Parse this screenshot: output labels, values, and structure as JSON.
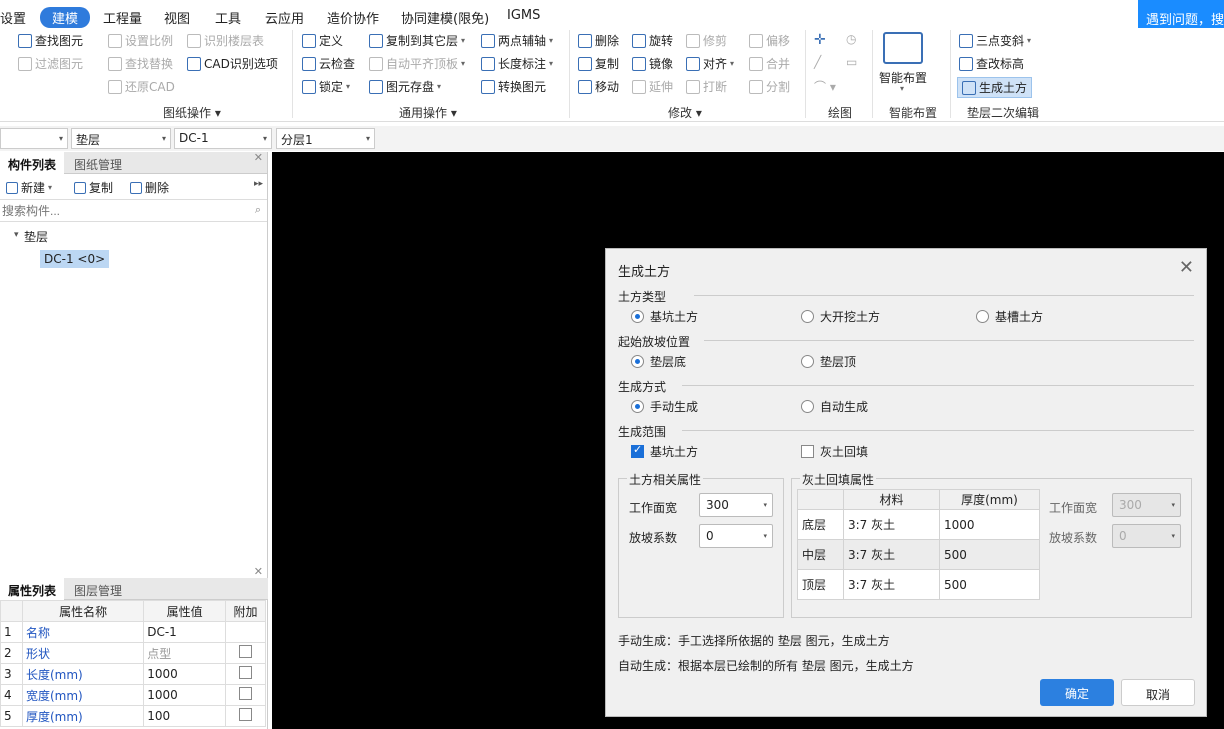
{
  "menu": {
    "items": [
      "设置",
      "建模",
      "工程量",
      "视图",
      "工具",
      "云应用",
      "造价协作",
      "协同建模(限免)",
      "IGMS"
    ],
    "active_index": 1
  },
  "help": "遇到问题，搜一",
  "ribbon": {
    "col1": [
      "查找图元",
      "过滤图元"
    ],
    "col2": [
      "设置比例",
      "识别楼层表",
      "查找替换",
      "CAD识别选项",
      "还原CAD"
    ],
    "group1": "图纸操作",
    "col3": [
      "定义",
      "复制到其它层",
      "两点辅轴",
      "云检查",
      "自动平齐顶板",
      "长度标注",
      "锁定",
      "图元存盘",
      "转换图元"
    ],
    "group2": "通用操作",
    "col4": [
      "删除",
      "旋转",
      "修剪",
      "偏移",
      "复制",
      "镜像",
      "对齐",
      "合并",
      "移动",
      "延伸",
      "打断",
      "分割"
    ],
    "group3": "修改",
    "group4": "绘图",
    "smart": "智能布置",
    "group5": "智能布置",
    "col5": [
      "三点变斜",
      "查改标高",
      "生成土方"
    ],
    "group6": "垫层二次编辑"
  },
  "selectors": [
    "",
    "垫层",
    "DC-1",
    "分层1"
  ],
  "left": {
    "tabs": [
      "构件列表",
      "图纸管理"
    ],
    "toolbar": [
      "新建",
      "复制",
      "删除"
    ],
    "search_placeholder": "搜索构件...",
    "tree_root": "垫层",
    "tree_item": "DC-1 <0>",
    "prop_tabs": [
      "属性列表",
      "图层管理"
    ],
    "prop_headers": [
      "属性名称",
      "属性值",
      "附加"
    ],
    "props": [
      {
        "n": "1",
        "name": "名称",
        "val": "DC-1",
        "chk": false
      },
      {
        "n": "2",
        "name": "形状",
        "val": "点型",
        "chk": true
      },
      {
        "n": "3",
        "name": "长度(mm)",
        "val": "1000",
        "chk": true
      },
      {
        "n": "4",
        "name": "宽度(mm)",
        "val": "1000",
        "chk": true
      },
      {
        "n": "5",
        "name": "厚度(mm)",
        "val": "100",
        "chk": true
      }
    ]
  },
  "dialog": {
    "title": "生成土方",
    "s1": "土方类型",
    "s1opts": [
      "基坑土方",
      "大开挖土方",
      "基槽土方"
    ],
    "s2": "起始放坡位置",
    "s2opts": [
      "垫层底",
      "垫层顶"
    ],
    "s3": "生成方式",
    "s3opts": [
      "手动生成",
      "自动生成"
    ],
    "s4": "生成范围",
    "s4opts": [
      "基坑土方",
      "灰土回填"
    ],
    "box1": "土方相关属性",
    "work_width": "工作面宽",
    "work_width_val": "300",
    "slope": "放坡系数",
    "slope_val": "0",
    "box2": "灰土回填属性",
    "thead": [
      "材料",
      "厚度(mm)"
    ],
    "rows": [
      [
        "底层",
        "3:7 灰土",
        "1000"
      ],
      [
        "中层",
        "3:7 灰土",
        "500"
      ],
      [
        "顶层",
        "3:7 灰土",
        "500"
      ]
    ],
    "work_width2_val": "300",
    "slope2_val": "0",
    "note1": "手动生成：手工选择所依据的 垫层 图元，生成土方",
    "note2": "自动生成：根据本层已绘制的所有 垫层 图元，生成土方",
    "ok": "确定",
    "cancel": "取消"
  }
}
